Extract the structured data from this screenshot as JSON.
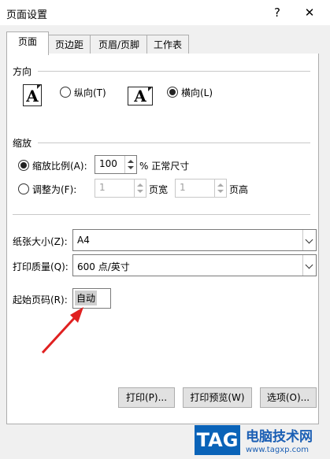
{
  "window": {
    "title": "页面设置",
    "help": "?",
    "close": "✕"
  },
  "tabs": [
    {
      "label": "页面",
      "active": true
    },
    {
      "label": "页边距",
      "active": false
    },
    {
      "label": "页眉/页脚",
      "active": false
    },
    {
      "label": "工作表",
      "active": false
    }
  ],
  "orientation": {
    "legend": "方向",
    "icon_letter": "A",
    "portrait_label": "纵向(T)",
    "landscape_label": "横向(L)",
    "selected": "landscape"
  },
  "scaling": {
    "legend": "缩放",
    "adjust_label": "缩放比例(A):",
    "adjust_value": "100",
    "adjust_suffix": "% 正常尺寸",
    "fit_label": "调整为(F):",
    "fit_wide_value": "1",
    "fit_wide_suffix": "页宽",
    "fit_tall_value": "1",
    "fit_tall_suffix": "页高",
    "selected": "adjust"
  },
  "paper": {
    "size_label": "纸张大小(Z):",
    "size_value": "A4",
    "quality_label": "打印质量(Q):",
    "quality_value": "600 点/英寸",
    "first_page_label": "起始页码(R):",
    "first_page_value": "自动"
  },
  "buttons": {
    "print": "打印(P)...",
    "preview": "打印预览(W)",
    "options": "选项(O)..."
  },
  "watermark": {
    "tag": "TAG",
    "text": "电脑技术网",
    "url": "www.tagxp.com"
  },
  "colors": {
    "arrow": "#e02020",
    "watermark_blue": "#0a63b8"
  }
}
